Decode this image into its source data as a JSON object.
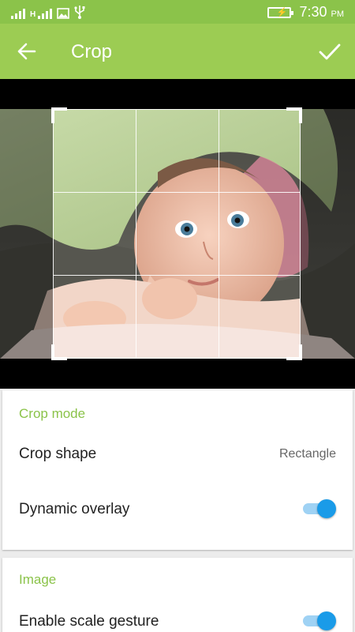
{
  "status_bar": {
    "network_type": "H",
    "time": "7:30",
    "ampm": "PM",
    "icons": [
      "signal-icon",
      "signal-icon",
      "image-icon",
      "usb-icon",
      "battery-charging-icon"
    ]
  },
  "app_bar": {
    "title": "Crop",
    "back_icon": "arrow-back-icon",
    "confirm_icon": "check-icon",
    "color": "#9ccc53"
  },
  "crop_view": {
    "grid": "3x3",
    "photo": "baby-under-blanket"
  },
  "settings": {
    "sections": [
      {
        "header": "Crop mode",
        "crop_shape_label": "Crop shape",
        "crop_shape_value": "Rectangle",
        "dynamic_overlay_label": "Dynamic overlay",
        "dynamic_overlay_on": true
      },
      {
        "header": "Image",
        "scale_gesture_label": "Enable scale gesture",
        "scale_gesture_on": true
      }
    ],
    "accent_color": "#8bc34a",
    "toggle_color": "#1a9be8"
  }
}
